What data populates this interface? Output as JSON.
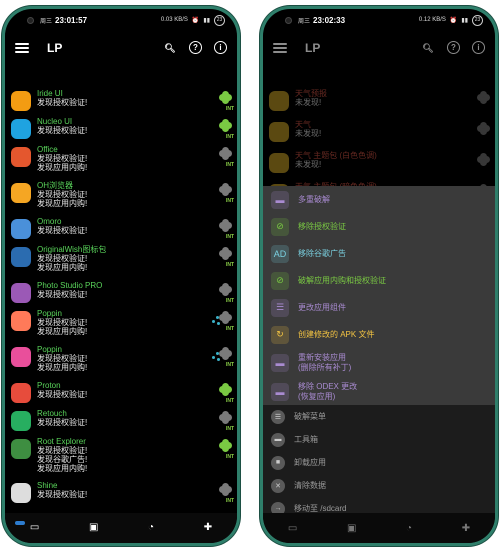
{
  "left_phone": {
    "status": {
      "day": "周三",
      "time": "23:01:57",
      "net": "0.03 KB/S",
      "battery": "23"
    },
    "app_title": "LP",
    "apps": [
      {
        "name": "Iride UI",
        "desc": "发现授权验证!",
        "icon_color": "#f39c12",
        "badge": "green-clover",
        "int": "INT"
      },
      {
        "name": "Nucleo UI",
        "desc": "发现授权验证!",
        "icon_color": "#1fa3e0",
        "badge": "green-clover",
        "int": "INT"
      },
      {
        "name": "Office",
        "desc": "发现授权验证!",
        "desc2": "发现应用内购!",
        "icon_color": "#e4572e",
        "badge": "gray-clover",
        "int": "INT"
      },
      {
        "name": "OH浏览器",
        "desc": "发现授权验证!",
        "desc2": "发现应用内购!",
        "icon_color": "#f5a623",
        "badge": "gray-clover",
        "int": "INT"
      },
      {
        "name": "Omoro",
        "desc": "发现授权验证!",
        "icon_color": "#4a90d9",
        "badge": "gray-clover",
        "int": "INT"
      },
      {
        "name": "OriginalWish图标包",
        "desc": "发现授权验证!",
        "desc2": "发现应用内购!",
        "icon_color": "#2b6cb0",
        "badge": "gray-clover",
        "int": "INT"
      },
      {
        "name": "Photo Studio PRO",
        "desc": "发现授权验证!",
        "icon_color": "#9b59b6",
        "badge": "gray-clover",
        "int": "INT"
      },
      {
        "name": "Poppin",
        "desc": "发现授权验证!",
        "desc2": "发现应用内购!",
        "icon_color": "#ff7a59",
        "badge": "gray-clover",
        "int": "INT"
      },
      {
        "name": "Poppin",
        "desc": "发现授权验证!",
        "desc2": "发现应用内购!",
        "icon_color": "#e94f9b",
        "badge": "gray-clover",
        "int": "INT"
      },
      {
        "name": "Proton",
        "desc": "发现授权验证!",
        "icon_color": "#e74c3c",
        "badge": "green-clover",
        "int": "INT"
      },
      {
        "name": "Retouch",
        "desc": "发现授权验证!",
        "icon_color": "#27ae60",
        "badge": "gray-clover",
        "int": "INT"
      },
      {
        "name": "Root Explorer",
        "desc": "发现授权验证!",
        "desc2": "发现谷歌广告!",
        "desc3": "发现应用内购!",
        "icon_color": "#3e8e41",
        "badge": "green-clover",
        "int": "INT"
      },
      {
        "name": "Shine",
        "desc": "发现授权验证!",
        "icon_color": "#dddddd",
        "badge": "gray-clover",
        "int": "INT"
      }
    ],
    "nav": [
      "",
      "",
      "",
      ""
    ]
  },
  "right_phone": {
    "status": {
      "day": "周三",
      "time": "23:02:33",
      "net": "0.12 KB/S",
      "battery": "23"
    },
    "app_title": "LP",
    "dimmed_apps": [
      {
        "name": "天气预报",
        "desc": "未发现!"
      },
      {
        "name": "天气",
        "desc": "未发现!"
      },
      {
        "name": "天气 主题包 (白色色调)",
        "desc": "未发现!"
      },
      {
        "name": "天气 主题包 (暗色色调)",
        "desc": "未发现!"
      }
    ],
    "menu": [
      {
        "label": "多重破解",
        "icon": "toolbox-icon",
        "color": "#a98bd1",
        "glyph": "▬"
      },
      {
        "label": "移除授权验证",
        "icon": "no-license-icon",
        "color": "#7ac943",
        "glyph": "⊘"
      },
      {
        "label": "移除谷歌广告",
        "icon": "no-ads-icon",
        "color": "#7ad0e0",
        "glyph": "AD"
      },
      {
        "label": "破解应用内购和授权验证",
        "icon": "crack-icon",
        "color": "#7ac943",
        "glyph": "⊘"
      },
      {
        "label": "更改应用组件",
        "icon": "components-icon",
        "color": "#a98bd1",
        "glyph": "☰"
      },
      {
        "label": "创建修改的 APK 文件",
        "icon": "apk-icon",
        "color": "#f5c542",
        "glyph": "↻"
      },
      {
        "label": "重新安装应用",
        "label2": "(删除所有补丁)",
        "icon": "reinstall-icon",
        "color": "#a98bd1",
        "glyph": "▬"
      },
      {
        "label": "移除 ODEX 更改",
        "label2": "(恢复应用)",
        "icon": "odex-icon",
        "color": "#a98bd1",
        "glyph": "▬"
      }
    ],
    "submenu": [
      {
        "label": "破解菜单",
        "glyph": "☰"
      },
      {
        "label": "工具箱",
        "glyph": "▬"
      },
      {
        "label": "卸载应用",
        "glyph": "■"
      },
      {
        "label": "清除数据",
        "glyph": "✕"
      },
      {
        "label": "移动至 /sdcard",
        "glyph": "→"
      }
    ]
  }
}
